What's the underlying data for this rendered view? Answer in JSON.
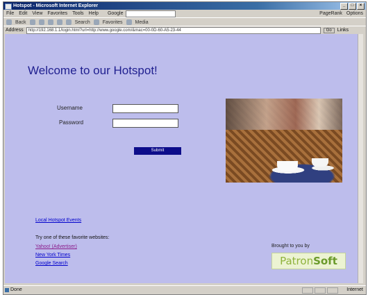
{
  "window": {
    "title": "Hotspot - Microsoft Internet Explorer"
  },
  "menu": {
    "items": [
      "File",
      "Edit",
      "View",
      "Favorites",
      "Tools",
      "Help"
    ],
    "google_label": "Google",
    "right_tools": [
      "PageRank",
      "Options"
    ]
  },
  "toolbar": {
    "items": [
      "Back",
      "Search",
      "Favorites",
      "Media"
    ]
  },
  "address": {
    "label": "Address",
    "url": "http://192.168.1.1/login.html?url=http://www.google.com/&mac=00-0D-60-A5-23-44",
    "go": "Go",
    "links": "Links"
  },
  "page": {
    "heading": "Welcome to our Hotspot!",
    "username_label": "Username",
    "password_label": "Password",
    "submit_label": "Submit",
    "local_link": "Local Hotspot Events",
    "favorites_label": "Try one of these favorite websites:",
    "favorites": [
      "Yahoo! (Advertiser)",
      "New York Times",
      "Google Search"
    ],
    "brought_by": "Brought to you by",
    "logo_text_a": "Patron",
    "logo_text_b": "Soft"
  },
  "status": {
    "text": "Done",
    "zone": "Internet"
  }
}
